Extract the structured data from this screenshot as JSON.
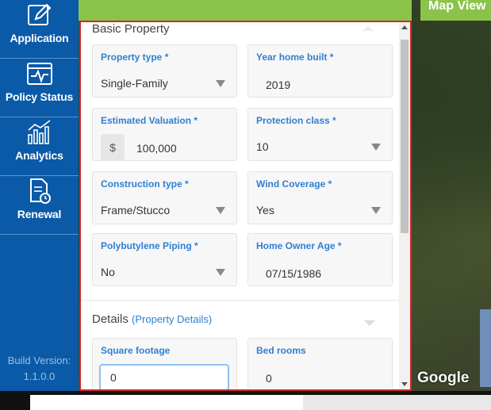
{
  "sidebar": {
    "items": [
      {
        "label": "Application",
        "icon": "edit-icon"
      },
      {
        "label": "Policy Status",
        "icon": "pulse-monitor-icon"
      },
      {
        "label": "Analytics",
        "icon": "bar-chart-icon"
      },
      {
        "label": "Renewal",
        "icon": "document-clock-icon"
      }
    ],
    "build_label": "Build Version:",
    "build_version": "1.1.0.0"
  },
  "map": {
    "view_button": "Map View",
    "attribution": "Google"
  },
  "basic_property": {
    "title": "Basic Property",
    "fields": {
      "property_type": {
        "label": "Property type *",
        "value": "Single-Family"
      },
      "year_built": {
        "label": "Year home built *",
        "value": "2019"
      },
      "estimated_valuation": {
        "label": "Estimated Valuation *",
        "currency": "$",
        "value": "100,000"
      },
      "protection_class": {
        "label": "Protection class *",
        "value": "10"
      },
      "construction_type": {
        "label": "Construction type *",
        "value": "Frame/Stucco"
      },
      "wind_coverage": {
        "label": "Wind Coverage *",
        "value": "Yes"
      },
      "polybutylene_piping": {
        "label": "Polybutylene Piping *",
        "value": "No"
      },
      "home_owner_age": {
        "label": "Home Owner Age *",
        "value": "07/15/1986"
      }
    }
  },
  "details": {
    "title": "Details",
    "subtitle": "(Property Details)",
    "fields": {
      "square_footage": {
        "label": "Square footage",
        "value": "0"
      },
      "bed_rooms": {
        "label": "Bed rooms",
        "value": "0"
      }
    }
  },
  "colors": {
    "sidebar": "#0a5aa8",
    "accent": "#2f7fd1",
    "highlight_border": "#d0282c",
    "map_header": "#8bc34a"
  }
}
